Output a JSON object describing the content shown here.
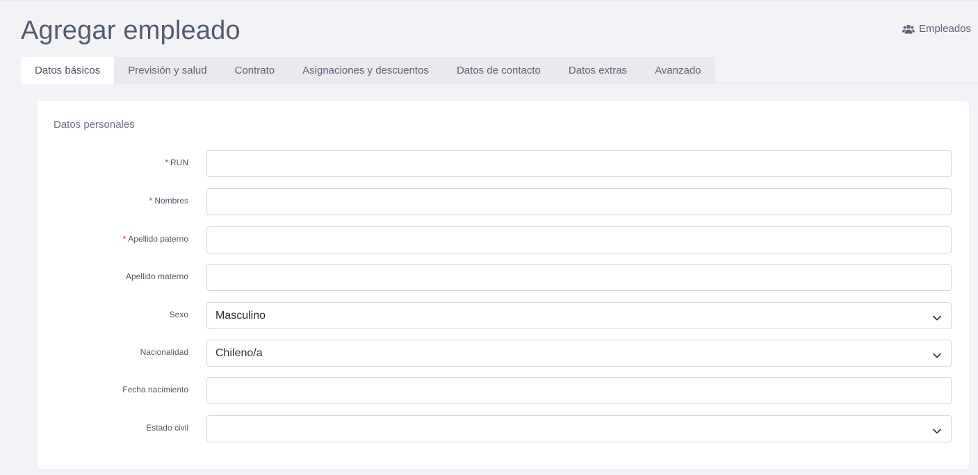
{
  "header": {
    "title": "Agregar empleado",
    "link_label": "Empleados",
    "link_icon": "users-icon"
  },
  "tabs": [
    {
      "label": "Datos básicos",
      "active": true
    },
    {
      "label": "Previsión y salud",
      "active": false
    },
    {
      "label": "Contrato",
      "active": false
    },
    {
      "label": "Asignaciones y descuentos",
      "active": false
    },
    {
      "label": "Datos de contacto",
      "active": false
    },
    {
      "label": "Datos extras",
      "active": false
    },
    {
      "label": "Avanzado",
      "active": false
    }
  ],
  "form": {
    "section_title": "Datos personales",
    "required_marker": "*",
    "fields": {
      "run": {
        "label": "RUN",
        "required": true,
        "value": ""
      },
      "nombres": {
        "label": "Nombres",
        "required": true,
        "value": ""
      },
      "apellido_paterno": {
        "label": "Apellido paterno",
        "required": true,
        "value": ""
      },
      "apellido_materno": {
        "label": "Apellido materno",
        "required": false,
        "value": ""
      },
      "sexo": {
        "label": "Sexo",
        "required": false,
        "value": "Masculino"
      },
      "nacionalidad": {
        "label": "Nacionalidad",
        "required": false,
        "value": "Chileno/a"
      },
      "fecha_nacimiento": {
        "label": "Fecha nacimiento",
        "required": false,
        "value": ""
      },
      "estado_civil": {
        "label": "Estado civil",
        "required": false,
        "value": ""
      }
    }
  },
  "colors": {
    "background": "#f3f3f7",
    "title": "#525c6e",
    "required": "#d9262c",
    "tab_bar": "#e9e9ee"
  }
}
